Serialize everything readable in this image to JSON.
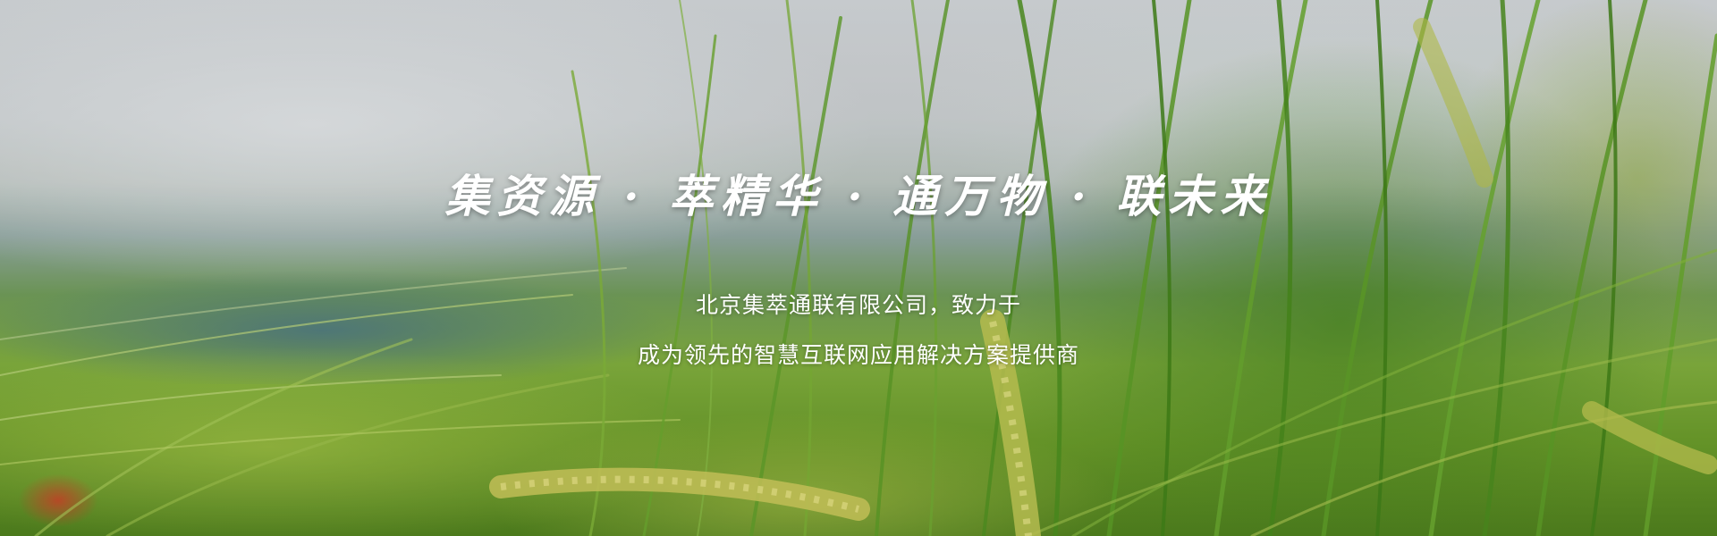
{
  "banner": {
    "headline": "集资源 · 萃精华 · 通万物 · 联未来",
    "subtitle_line1": "北京集萃通联有限公司，致力于",
    "subtitle_line2": "成为领先的智慧互联网应用解决方案提供商"
  },
  "colors": {
    "text": "#ffffff",
    "grass_green": "#5a9a28",
    "wheat_gold": "#c8c85a",
    "sky": "#cfd3d6"
  }
}
